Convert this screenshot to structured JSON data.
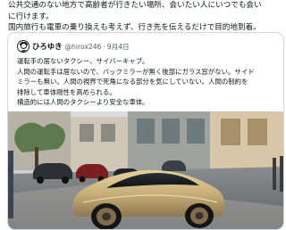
{
  "tweet": {
    "lines": [
      "公共交通のない地方で高齢者が行きたい場所、会いたい人にいつでも会い",
      "に行けます。",
      "国内旅行も電車の乗り換えも考えず、行き先を伝えるだけで目的地到着。"
    ]
  },
  "quoted": {
    "author_name": "ひろゆき",
    "handle": "@hirox246",
    "separator": "·",
    "date": "9月4日",
    "lines": [
      "運転手の居ないタクシー、サイバーキャブ。",
      "人間の運転手は居ないので、バックミラーが無く後部にガラス窓がない。サイド",
      "ミラーも無い。人間の視界で死角になる部分を気にしていない。人間の制約を",
      "排除して車体剛性を高められる。",
      "構造的には人間のタクシーより安全な車体。"
    ],
    "avatar_icon": "avatar-icon",
    "photo": {
      "subject": "gold-cybercab-car"
    }
  }
}
